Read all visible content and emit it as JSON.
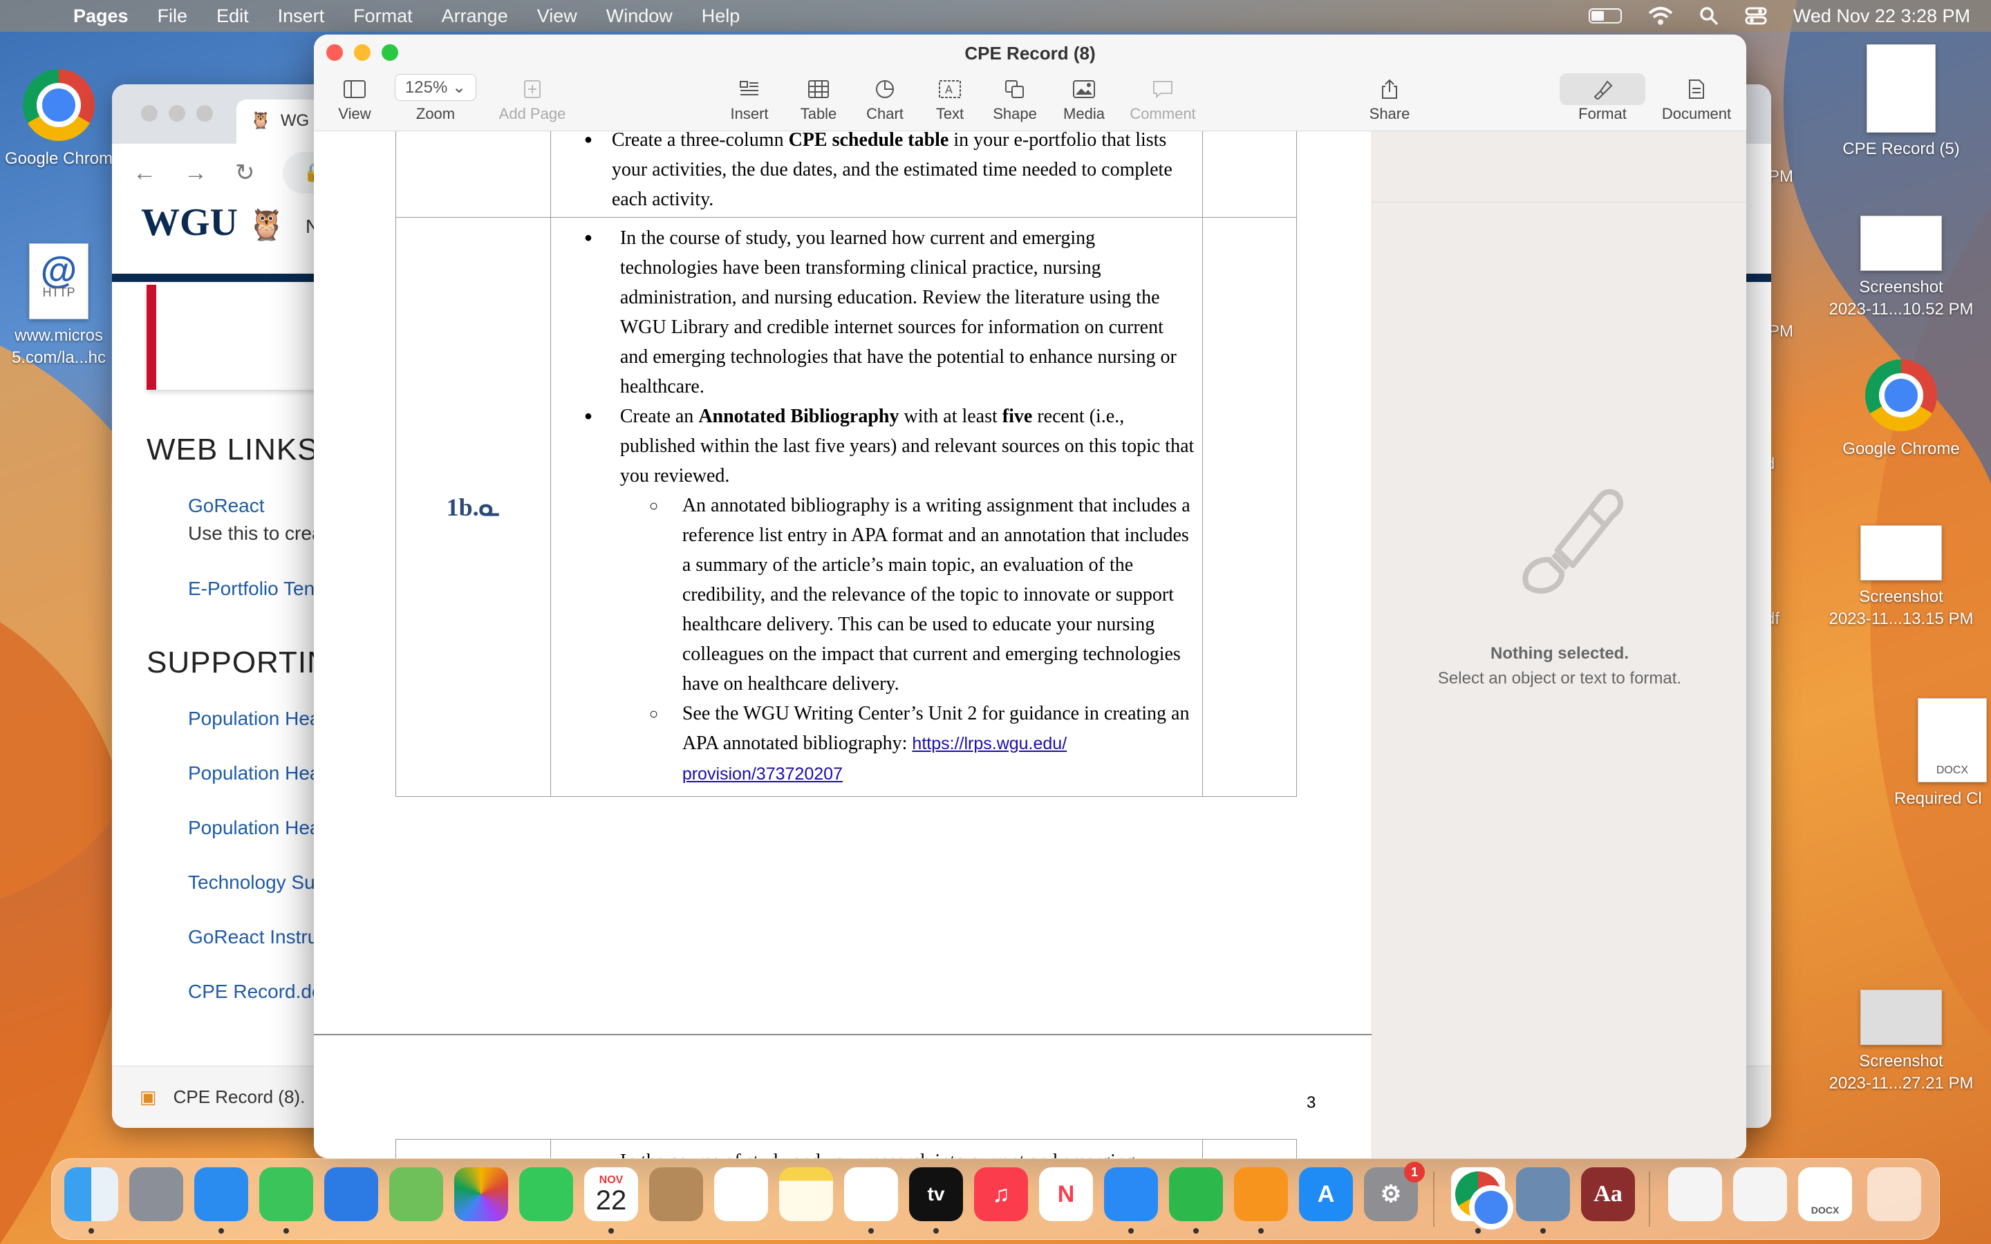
{
  "menubar": {
    "items": [
      "Pages",
      "File",
      "Edit",
      "Insert",
      "Format",
      "Arrange",
      "View",
      "Window",
      "Help"
    ],
    "clock": "Wed Nov 22  3:28 PM"
  },
  "desktop": {
    "left_icons": [
      {
        "label": "Google Chrom"
      },
      {
        "label_line1": "www.micros",
        "label_line2": "5.com/la...hc",
        "badge": "HTTP"
      }
    ],
    "right_icons": [
      {
        "label": "CPE Record (5)"
      },
      {
        "label_line1": "Screenshot",
        "label_line2": "2023-11...10.52 PM"
      },
      {
        "label": "Google Chrome"
      },
      {
        "label_line1": "Screenshot",
        "label_line2": "2023-11...13.15 PM"
      },
      {
        "label": "Required Cl",
        "badge": "DOCX"
      },
      {
        "label_line1": "Screenshot",
        "label_line2": "2023-11...27.21 PM"
      }
    ],
    "partial_labels": [
      "t",
      "3 PM",
      "t",
      "5 PM",
      "d",
      "df"
    ]
  },
  "browser": {
    "tab_title": "WG",
    "url_partial": "t",
    "nav_partial": "N",
    "logo": "WGU",
    "heading_web_links": "WEB LINKS",
    "goreact_link": "GoReact",
    "goreact_desc": "Use this to crea",
    "eportfolio_link": "E-Portfolio Ten",
    "heading_supporting": "SUPPORTIN",
    "support_links": [
      "Population Hea",
      "Population Hea",
      "Population Hea",
      "Technology Sur",
      "GoReact Instru",
      "CPE Record.do"
    ],
    "download_item": "CPE Record (8)."
  },
  "pages": {
    "title": "CPE Record (8)",
    "toolbar": {
      "view": "View",
      "zoom_value": "125%",
      "zoom": "Zoom",
      "add_page": "Add Page",
      "insert": "Insert",
      "table": "Table",
      "chart": "Chart",
      "text": "Text",
      "shape": "Shape",
      "media": "Media",
      "comment": "Comment",
      "share": "Share",
      "format": "Format",
      "document": "Document"
    },
    "sidebar": {
      "nothing_title": "Nothing selected.",
      "nothing_sub": "Select an object or text to format."
    },
    "doc": {
      "top_bullet_a": "Create a three-column ",
      "top_bullet_b": "CPE schedule table",
      "top_bullet_c": " in your e-portfolio that lists your activities, the due dates, and the estimated time needed to complete each activity.",
      "row_label": "1b.ᓇ",
      "b1": "In the course of study, you learned how current and emerging technologies have been transforming clinical practice, nursing administration, and nursing education. Review the literature using the WGU Library and credible internet sources for information on current and emerging technologies that have the potential to enhance nursing or healthcare.",
      "b2_a": "Create an ",
      "b2_b": "Annotated Bibliography",
      "b2_c": " with at least ",
      "b2_d": "five",
      "b2_e": " recent (i.e., published within the last five years) and relevant sources on this topic that you reviewed.",
      "s1": "An annotated bibliography is a writing assignment that includes a reference list entry in APA format and an annotation that includes a summary of the article’s main topic, an evaluation of the credibility, and the relevance of the topic to innovate or support healthcare delivery. This can be used to educate your nursing colleagues on the impact that current and emerging technologies have on healthcare delivery.",
      "s2": "See the WGU Writing Center’s Unit 2 for guidance in creating an APA annotated bibliography: ",
      "s2_link_1": " https://lrps.wgu.edu/",
      "s2_link_2": "provision/373720207",
      "page_number": "3",
      "next_b1": "In the course of study and your research into current and emerging technologies, there are many examples of technologies intersecting"
    }
  },
  "dock": {
    "calendar_month": "NOV",
    "calendar_day": "22",
    "settings_badge": "1",
    "tv_label": "tv",
    "dict_label": "Aa",
    "docx_label": "DOCX"
  }
}
